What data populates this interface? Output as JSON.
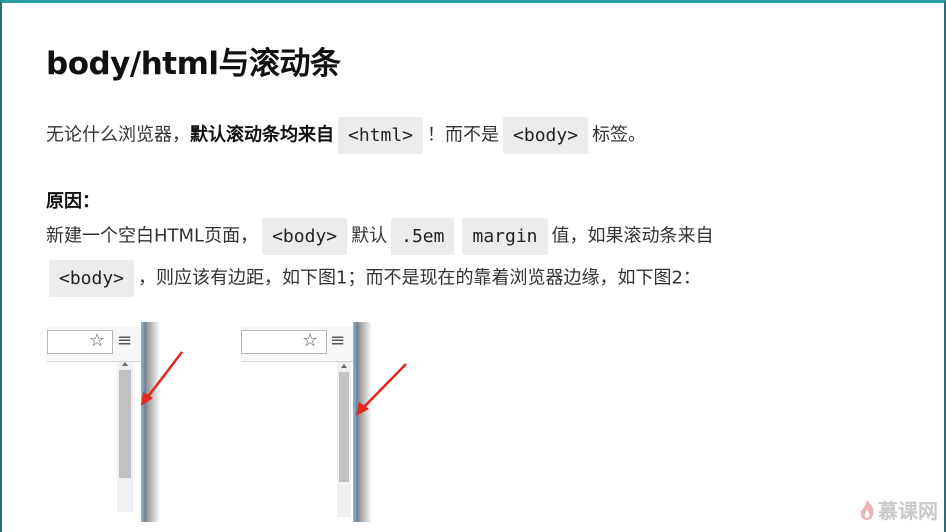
{
  "heading": "body/html与滚动条",
  "para1": {
    "t1": "无论什么浏览器，",
    "bold": "默认滚动条均来自",
    "code1": "<html>",
    "t2": "！而不是",
    "code2": "<body>",
    "t3": "标签。"
  },
  "reason_label": "原因：",
  "para2": {
    "t1": "新建一个空白HTML页面，",
    "code1": "<body>",
    "t2": "默认",
    "code2": ".5em",
    "code3": "margin",
    "t3": "值，如果滚动条来自",
    "code4": "<body>",
    "t4": "，则应该有边距，如下图1；而不是现在的靠着浏览器边缘，如下图2："
  },
  "icons": {
    "star": "star-icon",
    "menu": "menu-icon",
    "arrow": "red-arrow-icon",
    "logo": "flame-logo-icon"
  },
  "logo_text": "慕课网",
  "colors": {
    "accent_top_border": "#2a9ea0",
    "code_bg": "#ececec",
    "arrow_red": "#e3271e"
  }
}
